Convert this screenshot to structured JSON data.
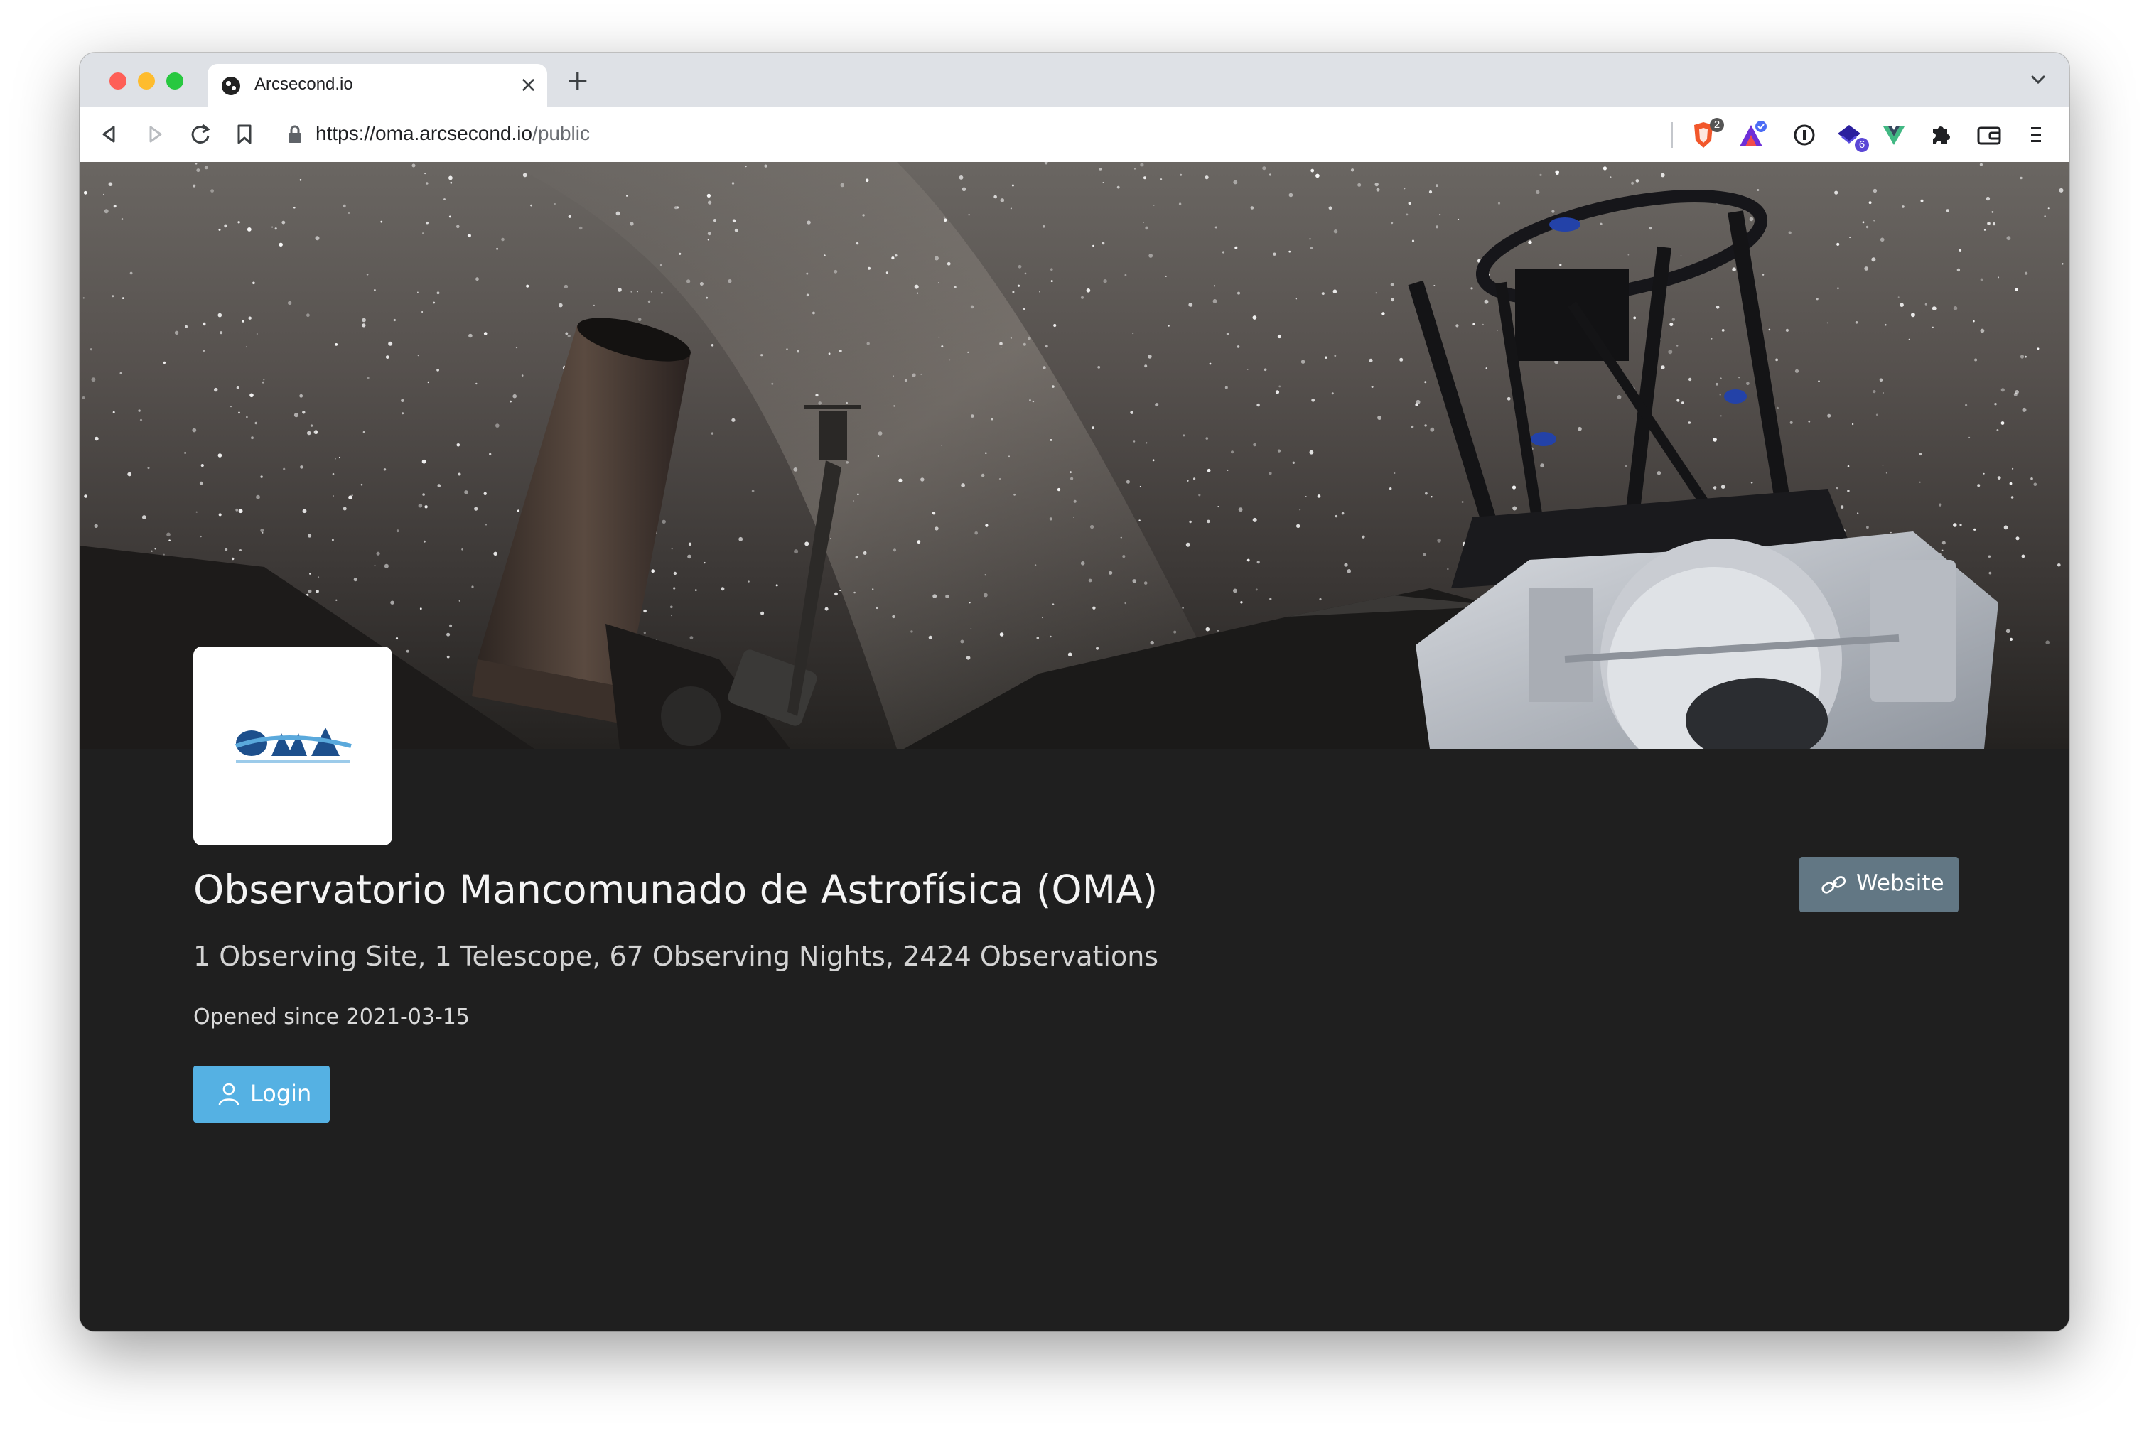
{
  "browser": {
    "tab_title": "Arcsecond.io",
    "tab_close": "×",
    "new_tab": "+",
    "url_host": "https://oma.arcsecond.io",
    "url_path": "/public",
    "extensions": [
      {
        "name": "brave-shields-icon",
        "badge": "2"
      },
      {
        "name": "brave-rewards-icon",
        "badge": ""
      },
      {
        "name": "password-manager-icon",
        "badge": ""
      },
      {
        "name": "extension-icon",
        "badge": "6"
      },
      {
        "name": "vue-devtools-icon",
        "badge": ""
      },
      {
        "name": "extensions-puzzle-icon",
        "badge": ""
      },
      {
        "name": "wallet-icon",
        "badge": ""
      },
      {
        "name": "menu-icon",
        "badge": ""
      }
    ]
  },
  "organisation": {
    "logo_text": "OMA",
    "name": "Observatorio Mancomunado de Astrofísica (OMA)",
    "stats": "1 Observing Site, 1 Telescope, 67 Observing Nights, 2424 Observations",
    "opened": "Opened since 2021-03-15",
    "login_label": "Login",
    "website_label": "Website"
  },
  "colors": {
    "page_background": "#1f1f1f",
    "login_button": "#55b1e3",
    "website_button": "#627784",
    "logo_blue": "#1d4f8c",
    "logo_light": "#5aa9dc"
  }
}
